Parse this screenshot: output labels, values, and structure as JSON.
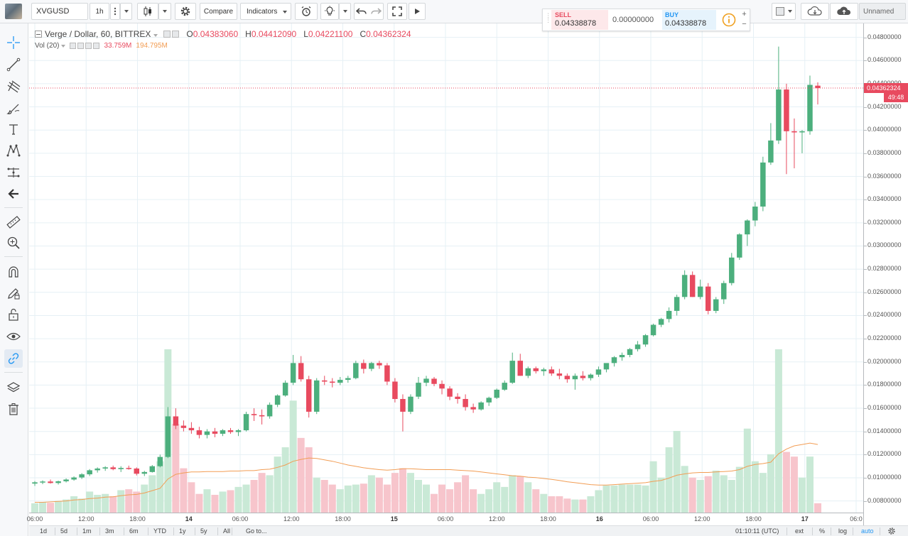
{
  "toolbar": {
    "symbol": "XVGUSD",
    "interval": "1h",
    "compare_label": "Compare",
    "indicators_label": "Indicators",
    "layout_name": "Unnamed"
  },
  "legend": {
    "title": "Verge / Dollar, 60, BITTREX",
    "o_label": "O",
    "o_value": "0.04383060",
    "h_label": "H",
    "h_value": "0.04412090",
    "l_label": "L",
    "l_value": "0.04221100",
    "c_label": "C",
    "c_value": "0.04362324",
    "vol_label": "Vol (20)",
    "vol_value": "33.759M",
    "vol_ma_value": "194.795M"
  },
  "order_panel": {
    "sell_label": "SELL",
    "sell_price": "0.04338878",
    "spread": "0.00000000",
    "buy_label": "BUY",
    "buy_price": "0.04338878",
    "plus": "+",
    "minus": "−"
  },
  "price_axis": {
    "ticks": [
      "0.04800000",
      "0.04600000",
      "0.04400000",
      "0.04200000",
      "0.04000000",
      "0.03800000",
      "0.03600000",
      "0.03400000",
      "0.03200000",
      "0.03000000",
      "0.02800000",
      "0.02600000",
      "0.02400000",
      "0.02200000",
      "0.02000000",
      "0.01800000",
      "0.01600000",
      "0.01400000",
      "0.01200000",
      "0.01000000",
      "0.00800000"
    ],
    "last_price": "0.04362324",
    "countdown": "49:48"
  },
  "time_axis": {
    "labels": [
      {
        "text": "06:00",
        "bold": false
      },
      {
        "text": "12:00",
        "bold": false
      },
      {
        "text": "18:00",
        "bold": false
      },
      {
        "text": "14",
        "bold": true
      },
      {
        "text": "06:00",
        "bold": false
      },
      {
        "text": "12:00",
        "bold": false
      },
      {
        "text": "18:00",
        "bold": false
      },
      {
        "text": "15",
        "bold": true
      },
      {
        "text": "06:00",
        "bold": false
      },
      {
        "text": "12:00",
        "bold": false
      },
      {
        "text": "18:00",
        "bold": false
      },
      {
        "text": "16",
        "bold": true
      },
      {
        "text": "06:00",
        "bold": false
      },
      {
        "text": "12:00",
        "bold": false
      },
      {
        "text": "18:00",
        "bold": false
      },
      {
        "text": "17",
        "bold": true
      },
      {
        "text": "06:0",
        "bold": false
      }
    ]
  },
  "bottom_bar": {
    "ranges": [
      "1d",
      "5d",
      "1m",
      "3m",
      "6m",
      "YTD",
      "1y",
      "5y",
      "All"
    ],
    "goto_label": "Go to...",
    "clock": "01:10:11 (UTC)",
    "ext_label": "ext",
    "pct_label": "%",
    "log_label": "log",
    "auto_label": "auto"
  },
  "colors": {
    "up": "#4caf7d",
    "down": "#e84a5f",
    "vol_up": "#c9e9d6",
    "vol_down": "#f7c5cc",
    "ma": "#f29d54",
    "grid": "#e6f0f5",
    "accent": "#2196f3"
  },
  "chart_data": {
    "type": "candlestick",
    "ylim": [
      0.007,
      0.0492
    ],
    "volume_max": 1,
    "candles": [
      [
        0.0095,
        0.00972,
        0.0093,
        0.00961
      ],
      [
        0.00961,
        0.00978,
        0.00945,
        0.00968
      ],
      [
        0.00968,
        0.00985,
        0.0095,
        0.00955
      ],
      [
        0.00955,
        0.00975,
        0.00942,
        0.0097
      ],
      [
        0.0097,
        0.00995,
        0.0096,
        0.00985
      ],
      [
        0.00985,
        0.01012,
        0.00975,
        0.01003
      ],
      [
        0.01003,
        0.0104,
        0.0099,
        0.0103
      ],
      [
        0.0103,
        0.01075,
        0.01015,
        0.01065
      ],
      [
        0.01065,
        0.0109,
        0.01045,
        0.0108
      ],
      [
        0.0108,
        0.011,
        0.0106,
        0.0109
      ],
      [
        0.0109,
        0.01105,
        0.01065,
        0.01075
      ],
      [
        0.01075,
        0.011,
        0.0105,
        0.01085
      ],
      [
        0.01085,
        0.01105,
        0.0107,
        0.0108
      ],
      [
        0.0108,
        0.0109,
        0.0102,
        0.01035
      ],
      [
        0.01035,
        0.0106,
        0.01015,
        0.0105
      ],
      [
        0.0105,
        0.0111,
        0.01045,
        0.011
      ],
      [
        0.011,
        0.012,
        0.0109,
        0.0118
      ],
      [
        0.0118,
        0.0161,
        0.0117,
        0.0153
      ],
      [
        0.0153,
        0.016,
        0.0142,
        0.0145
      ],
      [
        0.0145,
        0.01495,
        0.014,
        0.0143
      ],
      [
        0.0143,
        0.0148,
        0.0138,
        0.0141
      ],
      [
        0.0141,
        0.0144,
        0.0134,
        0.0137
      ],
      [
        0.0137,
        0.0142,
        0.0134,
        0.014
      ],
      [
        0.014,
        0.0143,
        0.0135,
        0.0138
      ],
      [
        0.0138,
        0.0142,
        0.0136,
        0.0141
      ],
      [
        0.0141,
        0.0143,
        0.0138,
        0.01395
      ],
      [
        0.01395,
        0.0142,
        0.0136,
        0.0141
      ],
      [
        0.0141,
        0.0157,
        0.014,
        0.0155
      ],
      [
        0.0155,
        0.016,
        0.0149,
        0.0154
      ],
      [
        0.0154,
        0.0159,
        0.0146,
        0.0153
      ],
      [
        0.0153,
        0.0165,
        0.0151,
        0.0163
      ],
      [
        0.0163,
        0.0172,
        0.0161,
        0.0171
      ],
      [
        0.0171,
        0.0184,
        0.017,
        0.0182
      ],
      [
        0.0182,
        0.0206,
        0.018,
        0.0199
      ],
      [
        0.0199,
        0.0205,
        0.0183,
        0.0185
      ],
      [
        0.0185,
        0.0188,
        0.0152,
        0.0157
      ],
      [
        0.0157,
        0.0186,
        0.0155,
        0.0184
      ],
      [
        0.0184,
        0.0188,
        0.018,
        0.0183
      ],
      [
        0.0183,
        0.0186,
        0.0178,
        0.0182
      ],
      [
        0.0182,
        0.0187,
        0.018,
        0.01845
      ],
      [
        0.01845,
        0.0188,
        0.0182,
        0.0186
      ],
      [
        0.0186,
        0.0201,
        0.0185,
        0.0199
      ],
      [
        0.0199,
        0.0202,
        0.019,
        0.0194
      ],
      [
        0.0194,
        0.02,
        0.0192,
        0.0199
      ],
      [
        0.0199,
        0.0201,
        0.0194,
        0.0197
      ],
      [
        0.0197,
        0.0199,
        0.018,
        0.0183
      ],
      [
        0.0183,
        0.0186,
        0.0165,
        0.0168
      ],
      [
        0.0168,
        0.0172,
        0.014,
        0.0157
      ],
      [
        0.0157,
        0.0172,
        0.0155,
        0.017
      ],
      [
        0.017,
        0.0187,
        0.0168,
        0.0182
      ],
      [
        0.0182,
        0.0188,
        0.0179,
        0.01855
      ],
      [
        0.01855,
        0.0187,
        0.0179,
        0.0181
      ],
      [
        0.0181,
        0.0184,
        0.0172,
        0.0177
      ],
      [
        0.0177,
        0.0179,
        0.0167,
        0.017
      ],
      [
        0.017,
        0.0173,
        0.0164,
        0.0168
      ],
      [
        0.0168,
        0.0172,
        0.0158,
        0.0161
      ],
      [
        0.0161,
        0.0164,
        0.0156,
        0.0159
      ],
      [
        0.0159,
        0.0166,
        0.0158,
        0.0165
      ],
      [
        0.0165,
        0.017,
        0.0162,
        0.0169
      ],
      [
        0.0169,
        0.0177,
        0.0168,
        0.0176
      ],
      [
        0.0176,
        0.0184,
        0.0175,
        0.0182
      ],
      [
        0.0182,
        0.0208,
        0.0181,
        0.0201
      ],
      [
        0.0201,
        0.0207,
        0.0188,
        0.0188
      ],
      [
        0.0188,
        0.0196,
        0.0186,
        0.01945
      ],
      [
        0.01945,
        0.0196,
        0.019,
        0.0192
      ],
      [
        0.0192,
        0.0195,
        0.0188,
        0.01935
      ],
      [
        0.01935,
        0.0196,
        0.0188,
        0.019
      ],
      [
        0.019,
        0.0194,
        0.0185,
        0.0188
      ],
      [
        0.0188,
        0.019,
        0.0182,
        0.0185
      ],
      [
        0.0185,
        0.019,
        0.0176,
        0.0188
      ],
      [
        0.0188,
        0.0192,
        0.0184,
        0.0186
      ],
      [
        0.0186,
        0.019,
        0.0184,
        0.0189
      ],
      [
        0.0189,
        0.0196,
        0.0187,
        0.01935
      ],
      [
        0.01935,
        0.0198,
        0.0191,
        0.0199
      ],
      [
        0.0199,
        0.0205,
        0.0196,
        0.0204
      ],
      [
        0.0204,
        0.0208,
        0.0201,
        0.0206
      ],
      [
        0.0206,
        0.0212,
        0.0204,
        0.0211
      ],
      [
        0.0211,
        0.0218,
        0.0209,
        0.0215
      ],
      [
        0.0215,
        0.0224,
        0.0213,
        0.0223
      ],
      [
        0.0223,
        0.0233,
        0.0222,
        0.0232
      ],
      [
        0.0232,
        0.0238,
        0.023,
        0.0237
      ],
      [
        0.0237,
        0.0247,
        0.0234,
        0.0244
      ],
      [
        0.0244,
        0.0258,
        0.024,
        0.0256
      ],
      [
        0.0256,
        0.0279,
        0.0254,
        0.0275
      ],
      [
        0.0275,
        0.0278,
        0.0256,
        0.0256
      ],
      [
        0.0256,
        0.0271,
        0.0254,
        0.0265
      ],
      [
        0.0265,
        0.0268,
        0.0241,
        0.0244
      ],
      [
        0.0244,
        0.0256,
        0.0242,
        0.0254
      ],
      [
        0.0254,
        0.027,
        0.025,
        0.0268
      ],
      [
        0.0268,
        0.0294,
        0.0266,
        0.029
      ],
      [
        0.029,
        0.0311,
        0.0288,
        0.031
      ],
      [
        0.031,
        0.0323,
        0.03,
        0.0322
      ],
      [
        0.0322,
        0.0338,
        0.0317,
        0.0334
      ],
      [
        0.0334,
        0.0377,
        0.033,
        0.0372
      ],
      [
        0.0372,
        0.0406,
        0.037,
        0.0391
      ],
      [
        0.0391,
        0.0472,
        0.0388,
        0.0435
      ],
      [
        0.0435,
        0.044,
        0.0362,
        0.0399
      ],
      [
        0.0399,
        0.041,
        0.0367,
        0.0398
      ],
      [
        0.0398,
        0.04,
        0.038,
        0.0399
      ],
      [
        0.0399,
        0.0447,
        0.0396,
        0.0439
      ],
      [
        0.04383,
        0.04412,
        0.04221,
        0.04362
      ]
    ],
    "volumes": [
      0.02,
      0.022,
      0.021,
      0.025,
      0.028,
      0.035,
      0.03,
      0.045,
      0.038,
      0.04,
      0.035,
      0.048,
      0.05,
      0.045,
      0.06,
      0.08,
      0.11,
      0.35,
      0.19,
      0.095,
      0.065,
      0.04,
      0.05,
      0.038,
      0.045,
      0.048,
      0.055,
      0.06,
      0.07,
      0.085,
      0.08,
      0.12,
      0.14,
      0.24,
      0.16,
      0.14,
      0.075,
      0.07,
      0.06,
      0.05,
      0.058,
      0.06,
      0.062,
      0.08,
      0.075,
      0.06,
      0.085,
      0.095,
      0.085,
      0.07,
      0.06,
      0.04,
      0.06,
      0.05,
      0.065,
      0.08,
      0.05,
      0.04,
      0.05,
      0.065,
      0.055,
      0.08,
      0.078,
      0.065,
      0.05,
      0.04,
      0.035,
      0.035,
      0.03,
      0.028,
      0.028,
      0.035,
      0.048,
      0.058,
      0.058,
      0.06,
      0.06,
      0.06,
      0.058,
      0.11,
      0.075,
      0.14,
      0.175,
      0.1,
      0.075,
      0.07,
      0.078,
      0.09,
      0.08,
      0.07,
      0.098,
      0.18,
      0.11,
      0.085,
      0.125,
      0.35,
      0.13,
      0.12,
      0.075,
      0.12,
      0.02
    ],
    "volume_ma": [
      0.022,
      0.022,
      0.023,
      0.024,
      0.025,
      0.027,
      0.028,
      0.03,
      0.031,
      0.033,
      0.034,
      0.036,
      0.038,
      0.039,
      0.042,
      0.047,
      0.052,
      0.072,
      0.082,
      0.085,
      0.087,
      0.087,
      0.088,
      0.088,
      0.088,
      0.089,
      0.089,
      0.09,
      0.09,
      0.092,
      0.093,
      0.097,
      0.102,
      0.11,
      0.114,
      0.117,
      0.116,
      0.113,
      0.11,
      0.106,
      0.102,
      0.099,
      0.096,
      0.094,
      0.092,
      0.091,
      0.092,
      0.094,
      0.094,
      0.093,
      0.092,
      0.092,
      0.092,
      0.092,
      0.091,
      0.09,
      0.089,
      0.087,
      0.085,
      0.083,
      0.081,
      0.079,
      0.078,
      0.076,
      0.075,
      0.073,
      0.071,
      0.069,
      0.066,
      0.064,
      0.062,
      0.06,
      0.059,
      0.059,
      0.06,
      0.061,
      0.062,
      0.063,
      0.064,
      0.067,
      0.069,
      0.074,
      0.08,
      0.083,
      0.085,
      0.086,
      0.086,
      0.087,
      0.088,
      0.089,
      0.092,
      0.099,
      0.103,
      0.105,
      0.108,
      0.126,
      0.136,
      0.143,
      0.146,
      0.149,
      0.146
    ]
  }
}
